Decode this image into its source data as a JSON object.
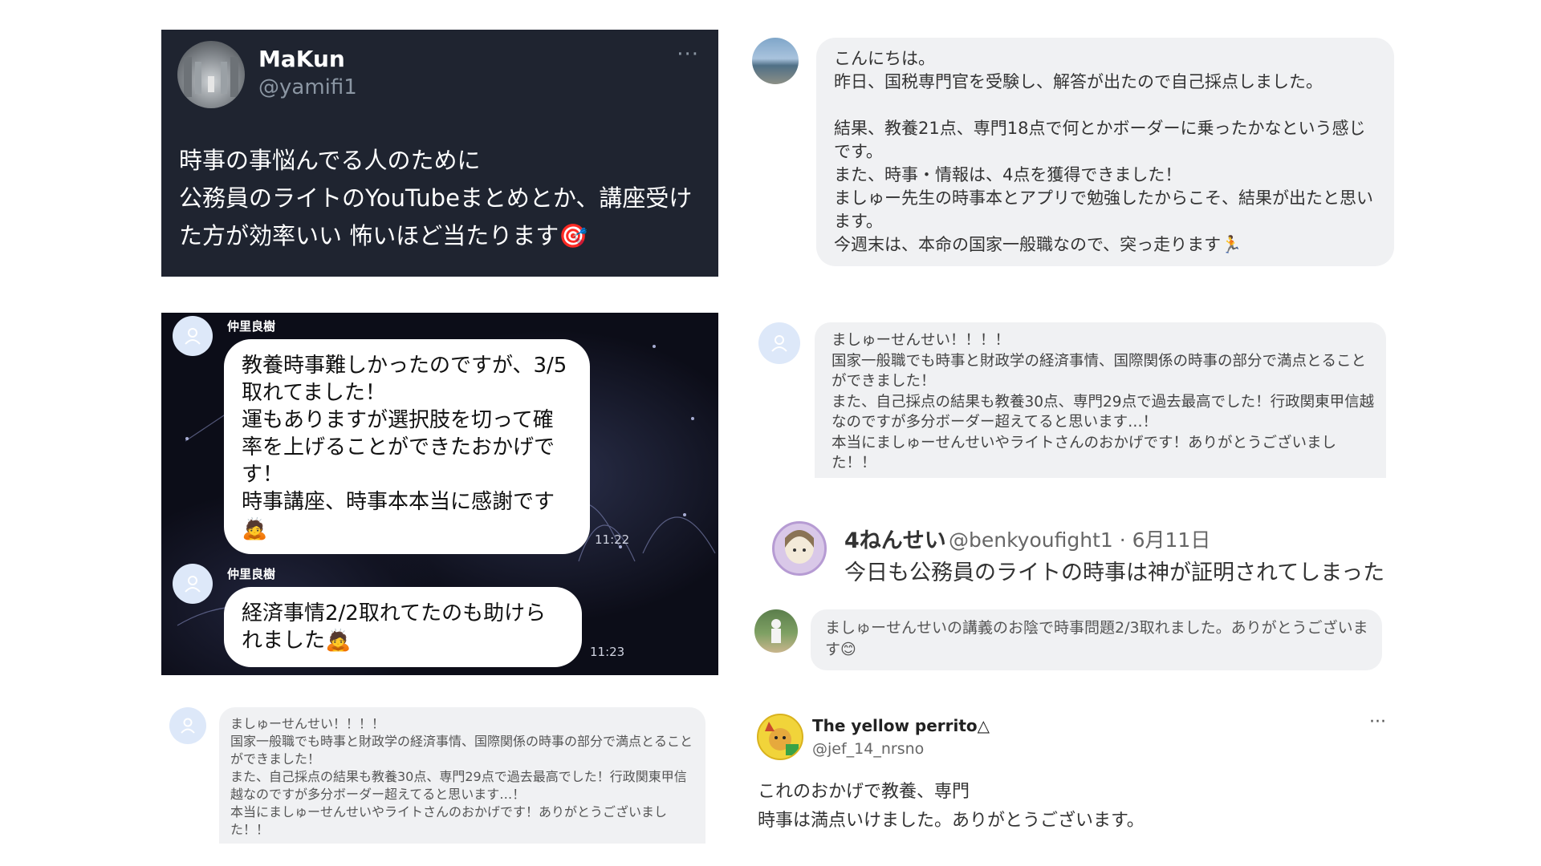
{
  "makun_card": {
    "name": "MaKun",
    "handle": "@yamifi1",
    "more": "···",
    "text": "時事の事悩んでる人のために\n公務員のライトのYouTubeまとめとか、講座受けた方が効率いい 怖いほど当たります🎯"
  },
  "top_right_comment": {
    "text": "こんにちは。\n昨日、国税専門官を受験し、解答が出たので自己採点しました。\n\n結果、教養21点、専門18点で何とかボーダーに乗ったかなという感じです。\nまた、時事・情報は、4点を獲得できました！\nましゅー先生の時事本とアプリで勉強したからこそ、結果が出たと思います。\n今週末は、本命の国家一般職なので、突っ走ります🏃"
  },
  "line_chat": {
    "messages": [
      {
        "sender": "仲里良樹",
        "text": "教養時事難しかったのですが、3/5取れてました！\n運もありますが選択肢を切って確率を上げることができたおかげです！\n時事講座、時事本本当に感謝です🙇",
        "time": "11:22"
      },
      {
        "sender": "仲里良樹",
        "text": "経済事情2/2取れてたのも助けられました🙇",
        "time": "11:23"
      }
    ]
  },
  "middle_right_comment": {
    "text": "ましゅーせんせい！！！！\n国家一般職でも時事と財政学の経済事情、国際関係の時事の部分で満点とることができました！\nまた、自己採点の結果も教養30点、専門29点で過去最高でした！行政関東甲信越なのですが多分ボーダー超えてると思います…！\n本当にましゅーせんせいやライトさんのおかげです！ありがとうございました！！"
  },
  "benkyou_tweet": {
    "name": "4ねんせい",
    "handle_date": "@benkyoufight1 · 6月11日",
    "text": "今日も公務員のライトの時事は神が証明されてしまった"
  },
  "baseball_comment": {
    "text": "ましゅーせんせいの講義のお陰で時事問題2/3取れました。ありがとうございます😊"
  },
  "bottom_left_comment": {
    "text": "ましゅーせんせい！！！！\n国家一般職でも時事と財政学の経済事情、国際関係の時事の部分で満点とることができました！\nまた、自己採点の結果も教養30点、専門29点で過去最高でした！行政関東甲信越なのですが多分ボーダー超えてると思います…！\n本当にましゅーせんせいやライトさんのおかげです！ありがとうございました！！"
  },
  "perrito_tweet": {
    "name": "The yellow perrito△",
    "handle": "@jef_14_nrsno",
    "more": "···",
    "text": "これのおかげで教養、専門\n時事は満点いけました。ありがとうございます。"
  }
}
